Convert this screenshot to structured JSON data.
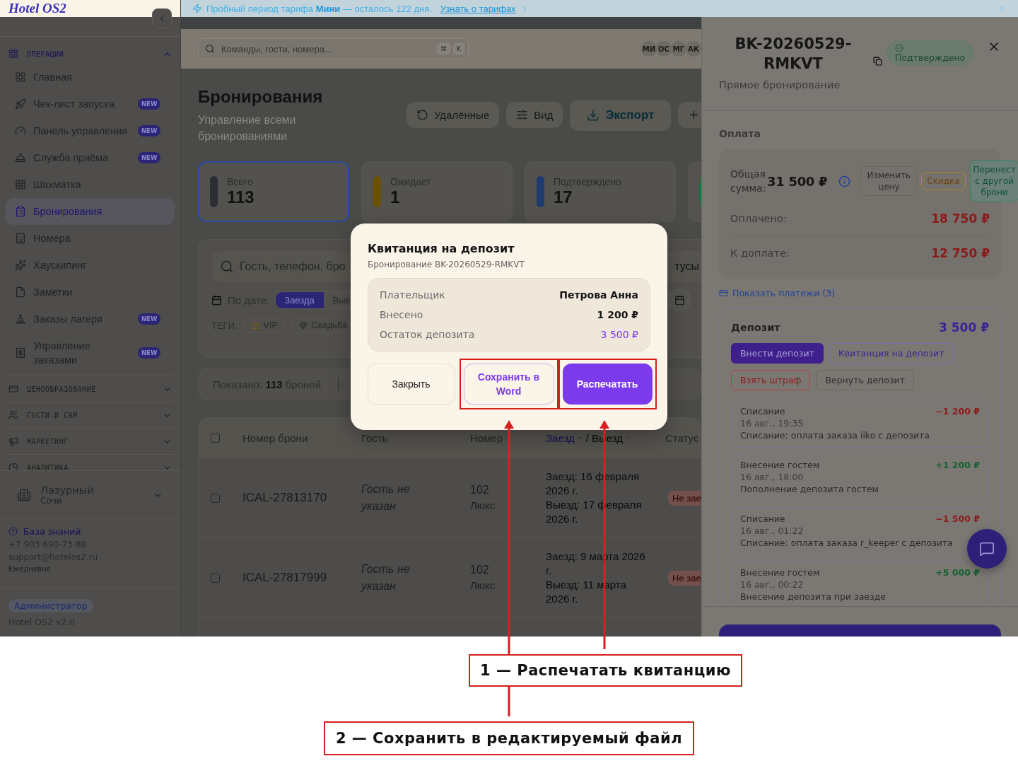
{
  "banner": {
    "text": "Пробный период тарифа **Мини** — осталось 122 дня.",
    "link": "Узнать о тарифах"
  },
  "sidebar": {
    "logo": "Hotel OS2",
    "sections": [
      {
        "title": "ОПЕРАЦИИ",
        "expanded": true,
        "items": [
          {
            "label": "Главная",
            "selected": false
          },
          {
            "label": "Чек-лист запуска",
            "selected": false,
            "badge": "NEW"
          },
          {
            "label": "Панель управления",
            "selected": false,
            "badge": "NEW"
          },
          {
            "label": "Служба приёма",
            "selected": false,
            "badge": "NEW"
          },
          {
            "label": "Шахматка",
            "selected": false
          },
          {
            "label": "Бронирования",
            "selected": true
          },
          {
            "label": "Номера",
            "selected": false
          },
          {
            "label": "Хаускипинг",
            "selected": false
          },
          {
            "label": "Заметки",
            "selected": false
          },
          {
            "label": "Заказы лагеря",
            "selected": false,
            "badge": "NEW"
          },
          {
            "label": "Управление заказами",
            "selected": false,
            "badge": "NEW"
          }
        ]
      },
      {
        "title": "ЦЕНООБРАЗОВАНИЕ",
        "expanded": false
      },
      {
        "title": "ГОСТИ И CRM",
        "expanded": false
      },
      {
        "title": "МАРКЕТИНГ",
        "expanded": false
      },
      {
        "title": "АНАЛИТИКА",
        "expanded": false
      }
    ],
    "property": {
      "name": "Лазурный",
      "city": "Сочи"
    },
    "help": {
      "link": "База знаний",
      "phone": "+7 903 690-73-88",
      "email": "support@hotelos2.ru",
      "hours": "Ежедневно"
    },
    "footer": {
      "role": "Администратор",
      "version": "Hotel OS2 v2.0"
    }
  },
  "topbar": {
    "search": {
      "placeholder": "Команды, гости, номера..."
    },
    "shortcut": [
      "⌘",
      "K"
    ],
    "avatars": [
      "МИ",
      "ОС",
      "МГ",
      "АК"
    ]
  },
  "page": {
    "title": "Бронирования",
    "subtitle": "Управление всеми бронированиями",
    "actions": [
      {
        "label": "Удалённые",
        "kind": "restore"
      },
      {
        "label": "Вид",
        "kind": "view"
      },
      {
        "label": "Экспорт",
        "kind": "export"
      },
      {
        "kind": "add"
      }
    ]
  },
  "stats": [
    {
      "label": "Всего",
      "value": "113",
      "color": "#2b2e35",
      "selected": true
    },
    {
      "label": "Ожидает",
      "value": "1",
      "color": "#6b5000",
      "selected": false
    },
    {
      "label": "Подтверждено",
      "value": "17",
      "color": "#1e3a6e",
      "selected": false
    },
    {
      "color": "#1c7a3c",
      "selected": false
    }
  ],
  "filters": {
    "search": {
      "placeholder": "Гость, телефон, бро"
    },
    "status_select": "тусы",
    "date": {
      "label": "По дате:",
      "options": [
        {
          "label": "Заезда",
          "selected": true
        },
        {
          "label": "Вые",
          "selected": false
        }
      ]
    },
    "tags": {
      "label": "ТЕГИ:",
      "items": [
        "VIP",
        "Свадьба"
      ]
    }
  },
  "summary": "Показано: **113** броней",
  "table": {
    "all_checked": false,
    "columns": [
      {
        "label": "Номер брони"
      },
      {
        "label": "Гость"
      },
      {
        "label": "Номер"
      },
      {
        "parts": [
          {
            "label": "Заезд",
            "sorted": true
          },
          {
            "label": "Выезд",
            "sorted": false
          }
        ],
        "separator": "/"
      },
      {
        "label": "Статус"
      }
    ],
    "rows": [
      {
        "checked": false,
        "id": "ICAL-27813170",
        "guest": "Гость не указан",
        "room": "102",
        "room_type": "Люкс",
        "checkin": "Заезд: 16 февраля 2026 г.",
        "checkout": "Выезд: 17 февраля 2026 г.",
        "status": "Не зае"
      },
      {
        "checked": false,
        "id": "ICAL-27817999",
        "guest": "Гость не указан",
        "room": "102",
        "room_type": "Люкс",
        "checkin": "Заезд: 9 марта 2026 г.",
        "checkout": "Выезд: 11 марта 2026 г.",
        "status": "Не зае"
      }
    ]
  },
  "drawer": {
    "title": "BK-20260529-RMKVT",
    "status": "Подтверждено",
    "subtitle": "Прямое бронирование",
    "payment": {
      "title": "Оплата",
      "total_label": "Общая сумма:",
      "total": "31 500 ₽",
      "actions": [
        {
          "label": "Изменить цену",
          "kind": "neutral"
        },
        {
          "label": "Скидка",
          "kind": "warning"
        },
        {
          "label": "Перенест с другой брони",
          "kind": "success"
        }
      ],
      "rows": [
        {
          "label": "Оплачено:",
          "value": "18 750 ₽"
        },
        {
          "label": "К доплате:",
          "value": "12 750 ₽"
        }
      ],
      "link": "Показать платежи (3)"
    },
    "deposit": {
      "title": "Депозит",
      "amount": "3 500 ₽",
      "actions": [
        {
          "label": "Внести депозит",
          "kind": "primary"
        },
        {
          "label": "Квитанция на депозит",
          "kind": "outline"
        },
        {
          "label": "Взять штраф",
          "kind": "danger"
        },
        {
          "label": "Вернуть депозит",
          "kind": "neutral"
        }
      ],
      "transactions": [
        {
          "kind": "debit",
          "title": "Списание",
          "time": "16 авг., 19:35",
          "amount": "−1 200 ₽",
          "note": "Списание: оплата заказа iiko с депозита"
        },
        {
          "kind": "credit",
          "title": "Внесение гостем",
          "time": "16 авг., 18:00",
          "amount": "+1 200 ₽",
          "note": "Пополнение депозита гостем"
        },
        {
          "kind": "debit",
          "title": "Списание",
          "time": "16 авг., 01:22",
          "amount": "−1 500 ₽",
          "note": "Списание: оплата заказа r_keeper с депозита"
        },
        {
          "kind": "credit",
          "title": "Внесение гостем",
          "time": "16 авг., 00:22",
          "amount": "+5 000 ₽",
          "note": "Внесение депозита при заезде"
        }
      ]
    }
  },
  "modal": {
    "title": "Квитанция на депозит",
    "subtitle": "Бронирование BK-20260529-RMKVT",
    "rows": [
      {
        "label": "Плательщик",
        "value": "Петрова Анна",
        "kind": "plain"
      },
      {
        "label": "Внесено",
        "value": "1 200 ₽",
        "kind": "plain"
      },
      {
        "label": "Остаток депозита",
        "value": "3 500 ₽",
        "kind": "accent"
      }
    ],
    "buttons": [
      {
        "label": "Закрыть",
        "kind": "secondary",
        "highlighted": false
      },
      {
        "label": "Сохранить в Word",
        "kind": "outline",
        "highlighted": true
      },
      {
        "label": "Распечатать",
        "kind": "primary",
        "highlighted": true
      }
    ]
  },
  "annotations": [
    "1 — Распечатать квитанцию",
    "2 — Сохранить в редактируемый файл"
  ]
}
